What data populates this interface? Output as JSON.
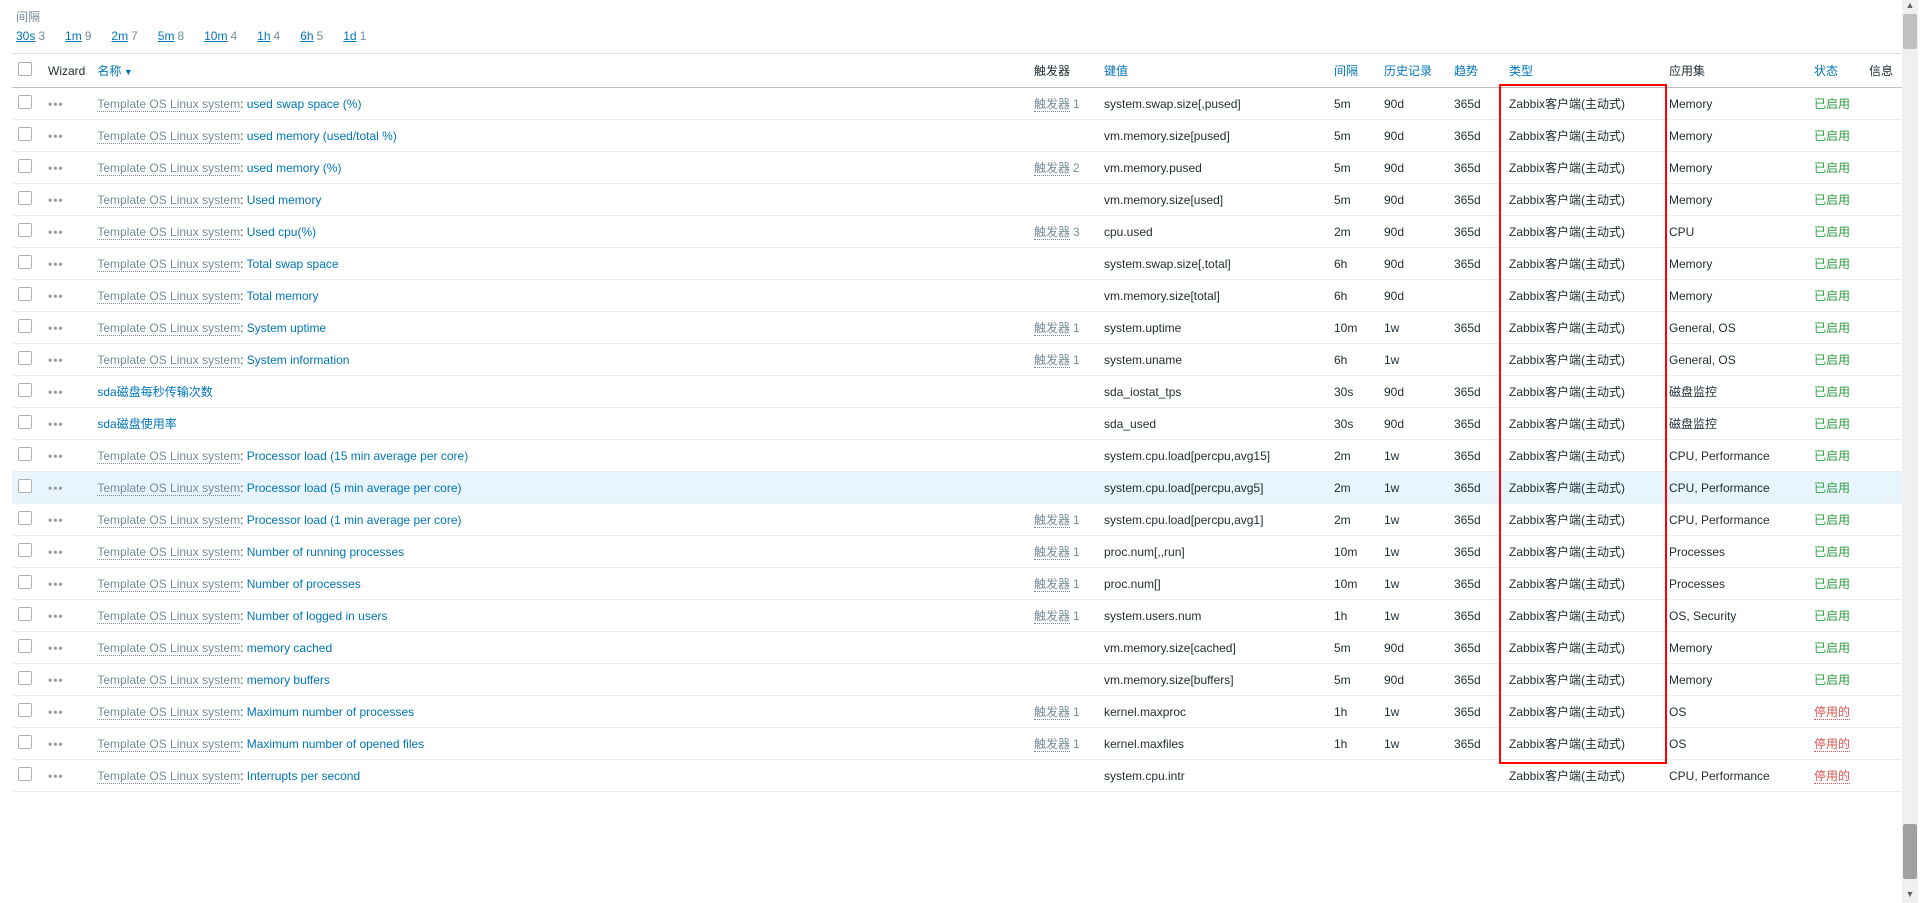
{
  "interval_label": "间隔",
  "intervals": [
    {
      "label": "30s",
      "count": "3"
    },
    {
      "label": "1m",
      "count": "9"
    },
    {
      "label": "2m",
      "count": "7"
    },
    {
      "label": "5m",
      "count": "8"
    },
    {
      "label": "10m",
      "count": "4"
    },
    {
      "label": "1h",
      "count": "4"
    },
    {
      "label": "6h",
      "count": "5"
    },
    {
      "label": "1d",
      "count": "1"
    }
  ],
  "headers": {
    "wizard": "Wizard",
    "name": "名称",
    "triggers": "触发器",
    "key": "键值",
    "interval": "间隔",
    "history": "历史记录",
    "trends": "趋势",
    "type": "类型",
    "apps": "应用集",
    "status": "状态",
    "info": "信息"
  },
  "trigger_label": "触发器",
  "status_enabled": "已启用",
  "status_disabled": "停用的",
  "type_value": "Zabbix客户端(主动式)",
  "prefix": "Template OS Linux system: ",
  "items": [
    {
      "prefix": true,
      "name": "used swap space (%)",
      "trig": "1",
      "key": "system.swap.size[,pused]",
      "int": "5m",
      "hist": "90d",
      "trend": "365d",
      "app": "Memory",
      "stat": "e"
    },
    {
      "prefix": true,
      "name": "used memory (used/total %)",
      "trig": "",
      "key": "vm.memory.size[pused]",
      "int": "5m",
      "hist": "90d",
      "trend": "365d",
      "app": "Memory",
      "stat": "e"
    },
    {
      "prefix": true,
      "name": "used memory (%)",
      "trig": "2",
      "key": "vm.memory.pused",
      "int": "5m",
      "hist": "90d",
      "trend": "365d",
      "app": "Memory",
      "stat": "e"
    },
    {
      "prefix": true,
      "name": "Used memory",
      "trig": "",
      "key": "vm.memory.size[used]",
      "int": "5m",
      "hist": "90d",
      "trend": "365d",
      "app": "Memory",
      "stat": "e"
    },
    {
      "prefix": true,
      "name": "Used cpu(%)",
      "trig": "3",
      "key": "cpu.used",
      "int": "2m",
      "hist": "90d",
      "trend": "365d",
      "app": "CPU",
      "stat": "e"
    },
    {
      "prefix": true,
      "name": "Total swap space",
      "trig": "",
      "key": "system.swap.size[,total]",
      "int": "6h",
      "hist": "90d",
      "trend": "365d",
      "app": "Memory",
      "stat": "e"
    },
    {
      "prefix": true,
      "name": "Total memory",
      "trig": "",
      "key": "vm.memory.size[total]",
      "int": "6h",
      "hist": "90d",
      "trend": "",
      "app": "Memory",
      "stat": "e"
    },
    {
      "prefix": true,
      "name": "System uptime",
      "trig": "1",
      "key": "system.uptime",
      "int": "10m",
      "hist": "1w",
      "trend": "365d",
      "app": "General, OS",
      "stat": "e"
    },
    {
      "prefix": true,
      "name": "System information",
      "trig": "1",
      "key": "system.uname",
      "int": "6h",
      "hist": "1w",
      "trend": "",
      "app": "General, OS",
      "stat": "e"
    },
    {
      "prefix": false,
      "name": "sda磁盘每秒传输次数",
      "trig": "",
      "key": "sda_iostat_tps",
      "int": "30s",
      "hist": "90d",
      "trend": "365d",
      "app": "磁盘监控",
      "stat": "e"
    },
    {
      "prefix": false,
      "name": "sda磁盘使用率",
      "trig": "",
      "key": "sda_used",
      "int": "30s",
      "hist": "90d",
      "trend": "365d",
      "app": "磁盘监控",
      "stat": "e"
    },
    {
      "prefix": true,
      "name": "Processor load (15 min average per core)",
      "trig": "",
      "key": "system.cpu.load[percpu,avg15]",
      "int": "2m",
      "hist": "1w",
      "trend": "365d",
      "app": "CPU, Performance",
      "stat": "e"
    },
    {
      "prefix": true,
      "name": "Processor load (5 min average per core)",
      "trig": "",
      "key": "system.cpu.load[percpu,avg5]",
      "int": "2m",
      "hist": "1w",
      "trend": "365d",
      "app": "CPU, Performance",
      "stat": "e",
      "hl": true
    },
    {
      "prefix": true,
      "name": "Processor load (1 min average per core)",
      "trig": "1",
      "key": "system.cpu.load[percpu,avg1]",
      "int": "2m",
      "hist": "1w",
      "trend": "365d",
      "app": "CPU, Performance",
      "stat": "e"
    },
    {
      "prefix": true,
      "name": "Number of running processes",
      "trig": "1",
      "key": "proc.num[,,run]",
      "int": "10m",
      "hist": "1w",
      "trend": "365d",
      "app": "Processes",
      "stat": "e"
    },
    {
      "prefix": true,
      "name": "Number of processes",
      "trig": "1",
      "key": "proc.num[]",
      "int": "10m",
      "hist": "1w",
      "trend": "365d",
      "app": "Processes",
      "stat": "e"
    },
    {
      "prefix": true,
      "name": "Number of logged in users",
      "trig": "1",
      "key": "system.users.num",
      "int": "1h",
      "hist": "1w",
      "trend": "365d",
      "app": "OS, Security",
      "stat": "e"
    },
    {
      "prefix": true,
      "name": "memory cached",
      "trig": "",
      "key": "vm.memory.size[cached]",
      "int": "5m",
      "hist": "90d",
      "trend": "365d",
      "app": "Memory",
      "stat": "e"
    },
    {
      "prefix": true,
      "name": "memory buffers",
      "trig": "",
      "key": "vm.memory.size[buffers]",
      "int": "5m",
      "hist": "90d",
      "trend": "365d",
      "app": "Memory",
      "stat": "e"
    },
    {
      "prefix": true,
      "name": "Maximum number of processes",
      "trig": "1",
      "key": "kernel.maxproc",
      "int": "1h",
      "hist": "1w",
      "trend": "365d",
      "app": "OS",
      "stat": "d"
    },
    {
      "prefix": true,
      "name": "Maximum number of opened files",
      "trig": "1",
      "key": "kernel.maxfiles",
      "int": "1h",
      "hist": "1w",
      "trend": "365d",
      "app": "OS",
      "stat": "d"
    },
    {
      "prefix": true,
      "name": "Interrupts per second",
      "trig": "",
      "key": "system.cpu.intr",
      "int": "",
      "hist": "",
      "trend": "",
      "app": "CPU, Performance",
      "stat": "d"
    }
  ]
}
